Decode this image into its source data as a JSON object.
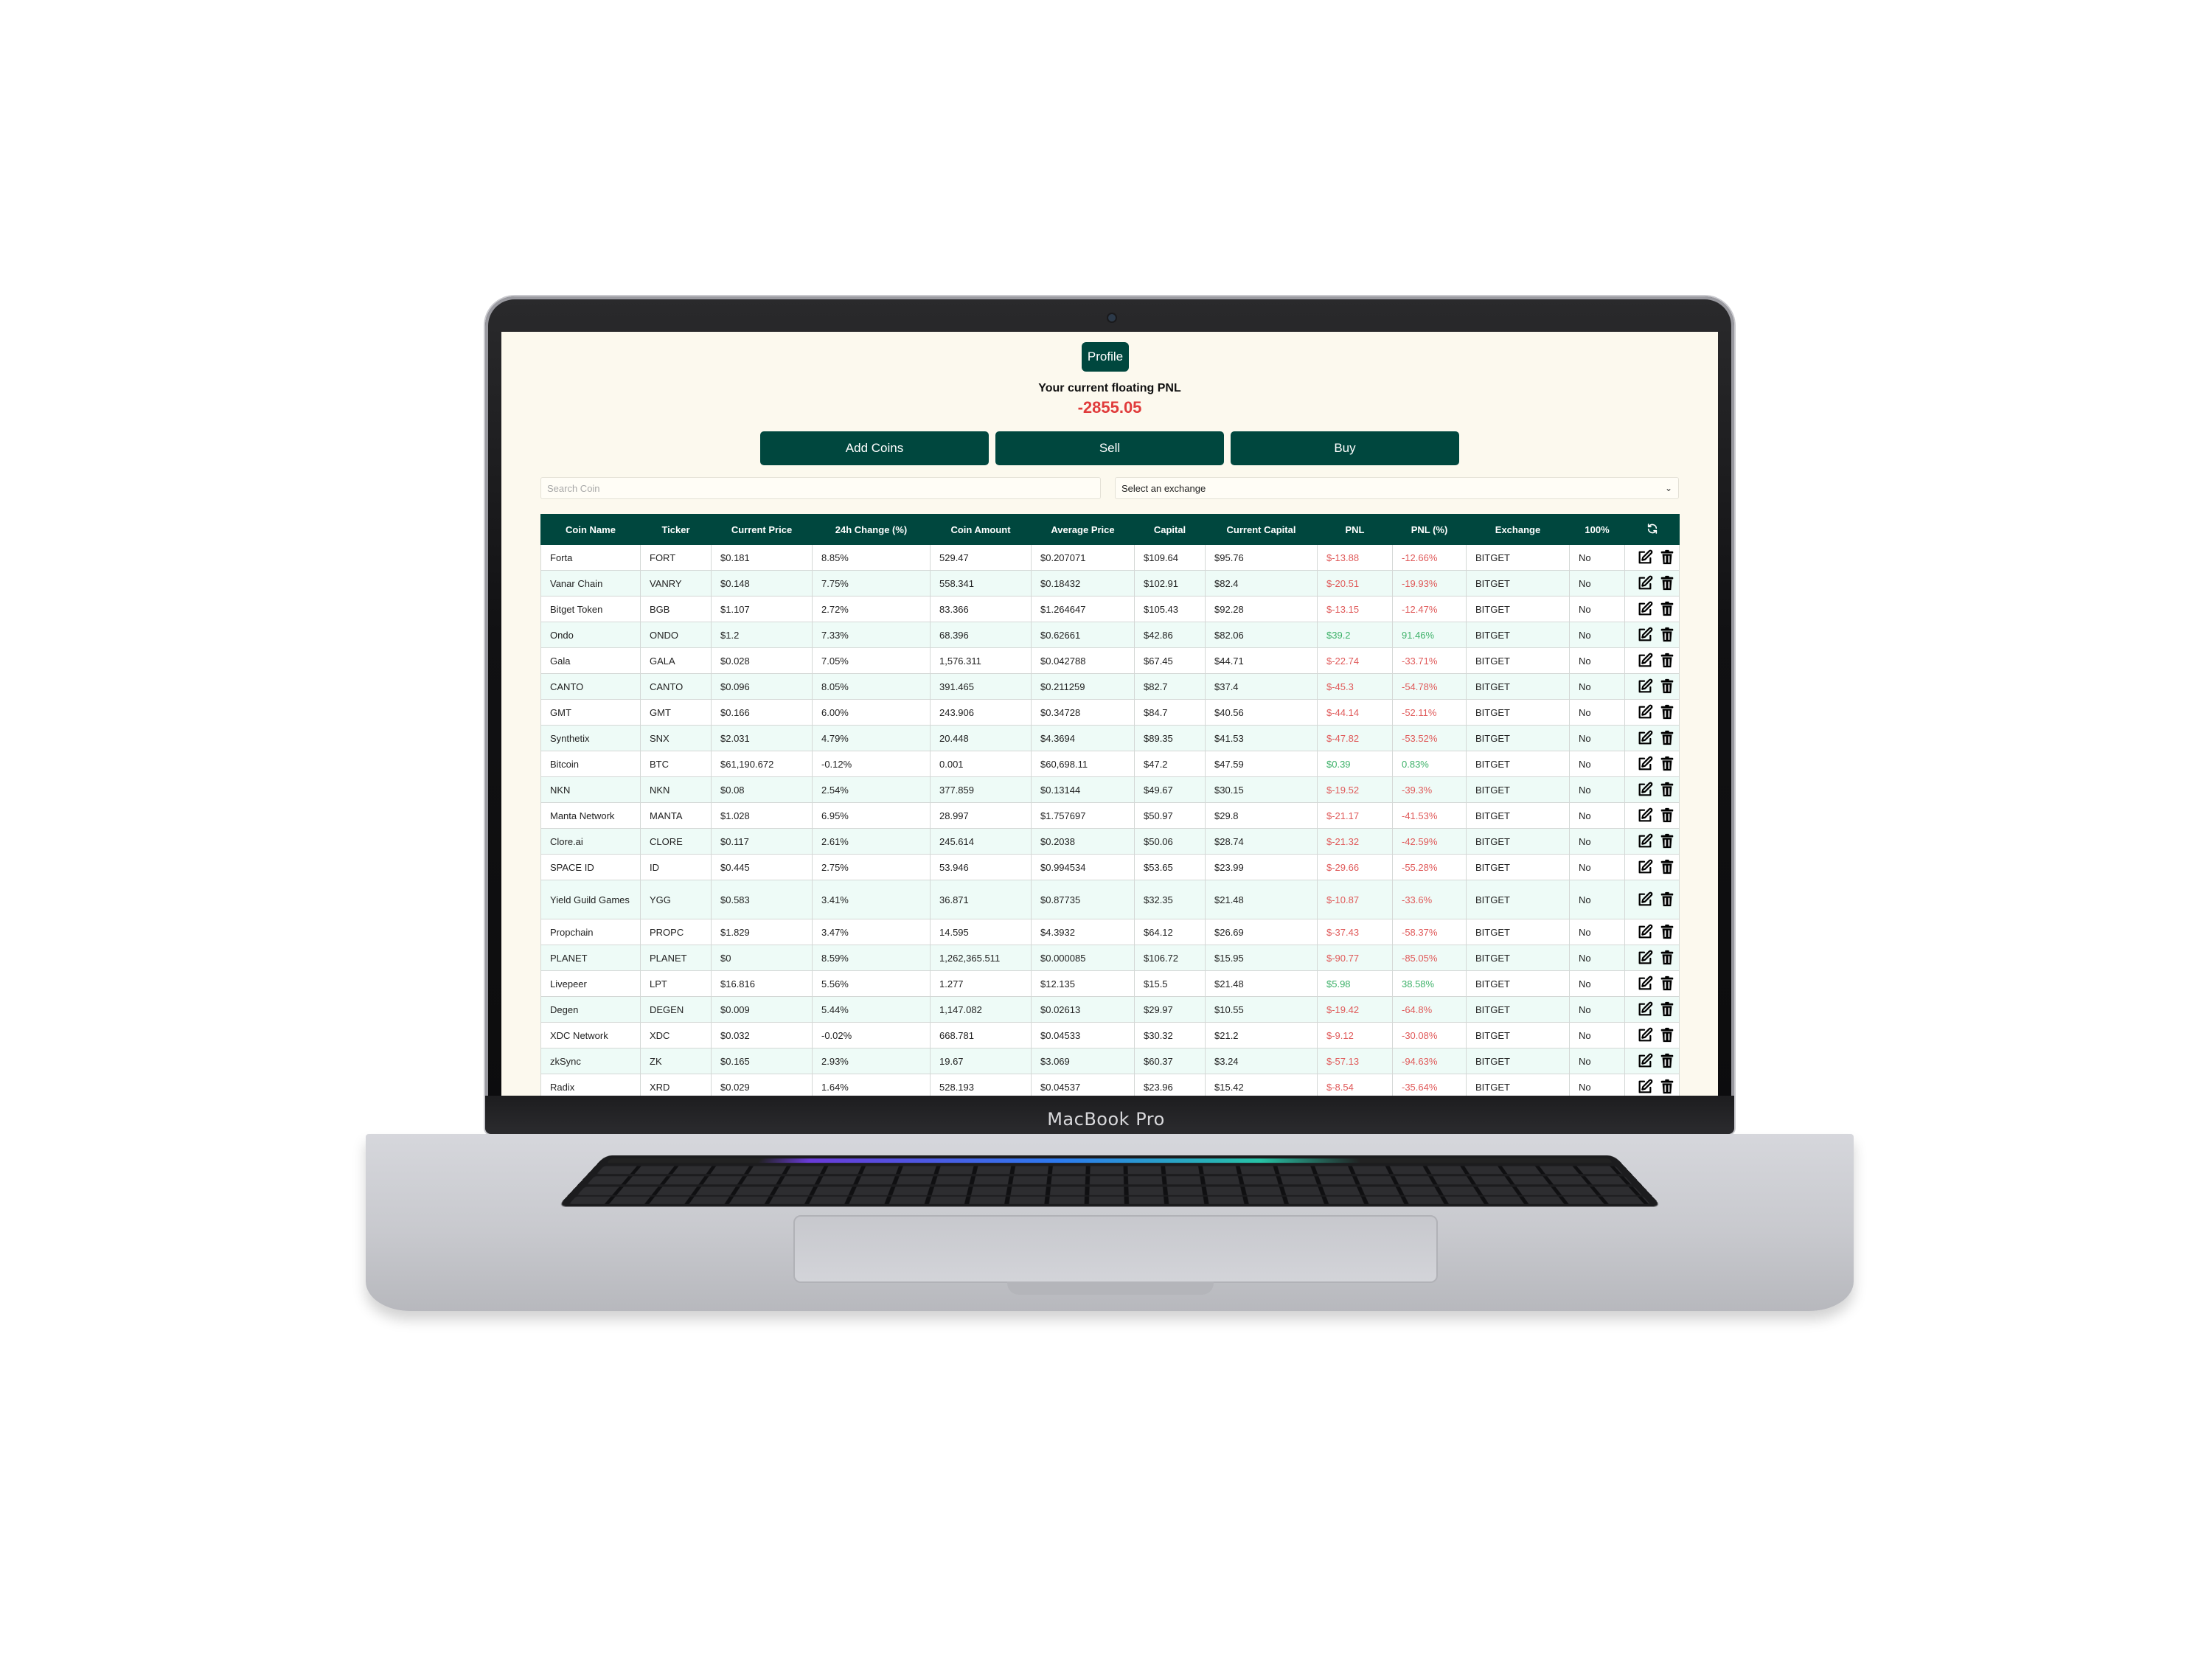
{
  "device": {
    "brand_label": "MacBook Pro"
  },
  "header": {
    "profile_label": "Profile",
    "pnl_label": "Your current floating PNL",
    "pnl_value": "-2855.05"
  },
  "actions": {
    "add_label": "Add Coins",
    "sell_label": "Sell",
    "buy_label": "Buy"
  },
  "filters": {
    "search_placeholder": "Search Coin",
    "exchange_placeholder": "Select an exchange"
  },
  "table": {
    "columns": [
      "Coin Name",
      "Ticker",
      "Current Price",
      "24h Change (%)",
      "Coin Amount",
      "Average Price",
      "Capital",
      "Current Capital",
      "PNL",
      "PNL (%)",
      "Exchange",
      "100%"
    ],
    "rows": [
      {
        "name": "Forta",
        "ticker": "FORT",
        "price": "$0.181",
        "change": "8.85%",
        "amount": "529.47",
        "avg": "$0.207071",
        "capital": "$109.64",
        "current": "$95.76",
        "pnl": "$-13.88",
        "pnl_pct": "-12.66%",
        "exchange": "BITGET",
        "full": "No"
      },
      {
        "name": "Vanar Chain",
        "ticker": "VANRY",
        "price": "$0.148",
        "change": "7.75%",
        "amount": "558.341",
        "avg": "$0.18432",
        "capital": "$102.91",
        "current": "$82.4",
        "pnl": "$-20.51",
        "pnl_pct": "-19.93%",
        "exchange": "BITGET",
        "full": "No"
      },
      {
        "name": "Bitget Token",
        "ticker": "BGB",
        "price": "$1.107",
        "change": "2.72%",
        "amount": "83.366",
        "avg": "$1.264647",
        "capital": "$105.43",
        "current": "$92.28",
        "pnl": "$-13.15",
        "pnl_pct": "-12.47%",
        "exchange": "BITGET",
        "full": "No"
      },
      {
        "name": "Ondo",
        "ticker": "ONDO",
        "price": "$1.2",
        "change": "7.33%",
        "amount": "68.396",
        "avg": "$0.62661",
        "capital": "$42.86",
        "current": "$82.06",
        "pnl": "$39.2",
        "pnl_pct": "91.46%",
        "exchange": "BITGET",
        "full": "No"
      },
      {
        "name": "Gala",
        "ticker": "GALA",
        "price": "$0.028",
        "change": "7.05%",
        "amount": "1,576.311",
        "avg": "$0.042788",
        "capital": "$67.45",
        "current": "$44.71",
        "pnl": "$-22.74",
        "pnl_pct": "-33.71%",
        "exchange": "BITGET",
        "full": "No"
      },
      {
        "name": "CANTO",
        "ticker": "CANTO",
        "price": "$0.096",
        "change": "8.05%",
        "amount": "391.465",
        "avg": "$0.211259",
        "capital": "$82.7",
        "current": "$37.4",
        "pnl": "$-45.3",
        "pnl_pct": "-54.78%",
        "exchange": "BITGET",
        "full": "No"
      },
      {
        "name": "GMT",
        "ticker": "GMT",
        "price": "$0.166",
        "change": "6.00%",
        "amount": "243.906",
        "avg": "$0.34728",
        "capital": "$84.7",
        "current": "$40.56",
        "pnl": "$-44.14",
        "pnl_pct": "-52.11%",
        "exchange": "BITGET",
        "full": "No"
      },
      {
        "name": "Synthetix",
        "ticker": "SNX",
        "price": "$2.031",
        "change": "4.79%",
        "amount": "20.448",
        "avg": "$4.3694",
        "capital": "$89.35",
        "current": "$41.53",
        "pnl": "$-47.82",
        "pnl_pct": "-53.52%",
        "exchange": "BITGET",
        "full": "No"
      },
      {
        "name": "Bitcoin",
        "ticker": "BTC",
        "price": "$61,190.672",
        "change": "-0.12%",
        "amount": "0.001",
        "avg": "$60,698.11",
        "capital": "$47.2",
        "current": "$47.59",
        "pnl": "$0.39",
        "pnl_pct": "0.83%",
        "exchange": "BITGET",
        "full": "No"
      },
      {
        "name": "NKN",
        "ticker": "NKN",
        "price": "$0.08",
        "change": "2.54%",
        "amount": "377.859",
        "avg": "$0.13144",
        "capital": "$49.67",
        "current": "$30.15",
        "pnl": "$-19.52",
        "pnl_pct": "-39.3%",
        "exchange": "BITGET",
        "full": "No"
      },
      {
        "name": "Manta Network",
        "ticker": "MANTA",
        "price": "$1.028",
        "change": "6.95%",
        "amount": "28.997",
        "avg": "$1.757697",
        "capital": "$50.97",
        "current": "$29.8",
        "pnl": "$-21.17",
        "pnl_pct": "-41.53%",
        "exchange": "BITGET",
        "full": "No"
      },
      {
        "name": "Clore.ai",
        "ticker": "CLORE",
        "price": "$0.117",
        "change": "2.61%",
        "amount": "245.614",
        "avg": "$0.2038",
        "capital": "$50.06",
        "current": "$28.74",
        "pnl": "$-21.32",
        "pnl_pct": "-42.59%",
        "exchange": "BITGET",
        "full": "No"
      },
      {
        "name": "SPACE ID",
        "ticker": "ID",
        "price": "$0.445",
        "change": "2.75%",
        "amount": "53.946",
        "avg": "$0.994534",
        "capital": "$53.65",
        "current": "$23.99",
        "pnl": "$-29.66",
        "pnl_pct": "-55.28%",
        "exchange": "BITGET",
        "full": "No"
      },
      {
        "name": "Yield Guild Games",
        "ticker": "YGG",
        "price": "$0.583",
        "change": "3.41%",
        "amount": "36.871",
        "avg": "$0.87735",
        "capital": "$32.35",
        "current": "$21.48",
        "pnl": "$-10.87",
        "pnl_pct": "-33.6%",
        "exchange": "BITGET",
        "full": "No"
      },
      {
        "name": "Propchain",
        "ticker": "PROPC",
        "price": "$1.829",
        "change": "3.47%",
        "amount": "14.595",
        "avg": "$4.3932",
        "capital": "$64.12",
        "current": "$26.69",
        "pnl": "$-37.43",
        "pnl_pct": "-58.37%",
        "exchange": "BITGET",
        "full": "No"
      },
      {
        "name": "PLANET",
        "ticker": "PLANET",
        "price": "$0",
        "change": "8.59%",
        "amount": "1,262,365.511",
        "avg": "$0.000085",
        "capital": "$106.72",
        "current": "$15.95",
        "pnl": "$-90.77",
        "pnl_pct": "-85.05%",
        "exchange": "BITGET",
        "full": "No"
      },
      {
        "name": "Livepeer",
        "ticker": "LPT",
        "price": "$16.816",
        "change": "5.56%",
        "amount": "1.277",
        "avg": "$12.135",
        "capital": "$15.5",
        "current": "$21.48",
        "pnl": "$5.98",
        "pnl_pct": "38.58%",
        "exchange": "BITGET",
        "full": "No"
      },
      {
        "name": "Degen",
        "ticker": "DEGEN",
        "price": "$0.009",
        "change": "5.44%",
        "amount": "1,147.082",
        "avg": "$0.02613",
        "capital": "$29.97",
        "current": "$10.55",
        "pnl": "$-19.42",
        "pnl_pct": "-64.8%",
        "exchange": "BITGET",
        "full": "No"
      },
      {
        "name": "XDC Network",
        "ticker": "XDC",
        "price": "$0.032",
        "change": "-0.02%",
        "amount": "668.781",
        "avg": "$0.04533",
        "capital": "$30.32",
        "current": "$21.2",
        "pnl": "$-9.12",
        "pnl_pct": "-30.08%",
        "exchange": "BITGET",
        "full": "No"
      },
      {
        "name": "zkSync",
        "ticker": "ZK",
        "price": "$0.165",
        "change": "2.93%",
        "amount": "19.67",
        "avg": "$3.069",
        "capital": "$60.37",
        "current": "$3.24",
        "pnl": "$-57.13",
        "pnl_pct": "-94.63%",
        "exchange": "BITGET",
        "full": "No"
      },
      {
        "name": "Radix",
        "ticker": "XRD",
        "price": "$0.029",
        "change": "1.64%",
        "amount": "528.193",
        "avg": "$0.04537",
        "capital": "$23.96",
        "current": "$15.42",
        "pnl": "$-8.54",
        "pnl_pct": "-35.64%",
        "exchange": "BITGET",
        "full": "No"
      }
    ]
  },
  "icons": {
    "refresh": "refresh-icon",
    "edit": "edit-icon",
    "delete": "trash-icon"
  },
  "colors": {
    "brand": "#00473e",
    "background": "#fcf9ee",
    "negative": "#e05a5a",
    "positive": "#3fb26a",
    "pnl_total": "#e03b3b",
    "row_alt": "#eefbf7"
  }
}
